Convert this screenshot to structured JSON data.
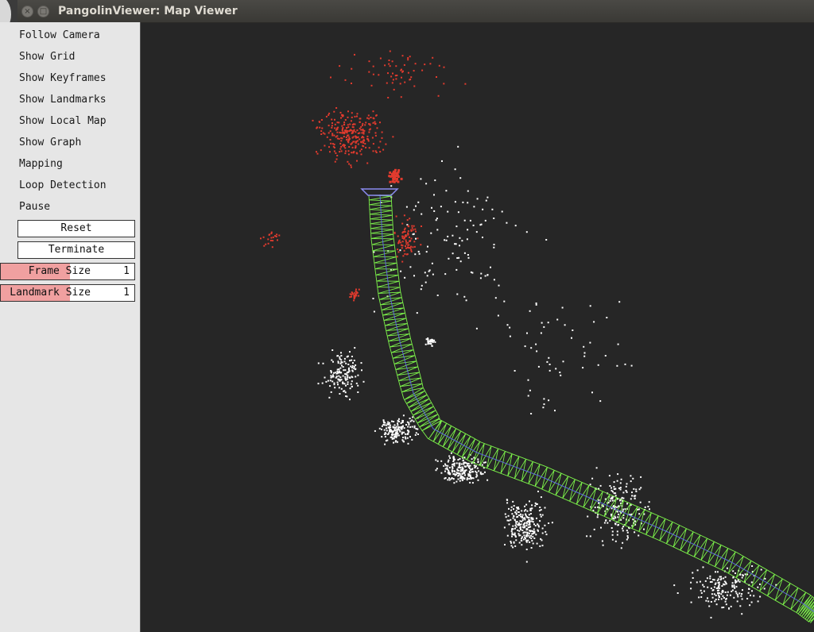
{
  "window": {
    "title": "PangolinViewer: Map Viewer"
  },
  "panel": {
    "checkboxes": [
      {
        "label": "Follow Camera"
      },
      {
        "label": "Show Grid"
      },
      {
        "label": "Show Keyframes"
      },
      {
        "label": "Show Landmarks"
      },
      {
        "label": "Show Local Map"
      },
      {
        "label": "Show Graph"
      },
      {
        "label": "Mapping"
      },
      {
        "label": "Loop Detection"
      },
      {
        "label": "Pause"
      }
    ],
    "buttons": [
      {
        "label": "Reset"
      },
      {
        "label": "Terminate"
      }
    ],
    "variables": [
      {
        "label": "Frame Size",
        "value": "1"
      },
      {
        "label": "Landmark Size",
        "value": "1"
      }
    ]
  },
  "colors": {
    "background": "#262626",
    "panel": "#e6e6e6",
    "keyframe": "#7cf24a",
    "local_landmark": "#e23b2e",
    "landmark": "#ffffff",
    "current_camera": "#8a8cf0"
  }
}
